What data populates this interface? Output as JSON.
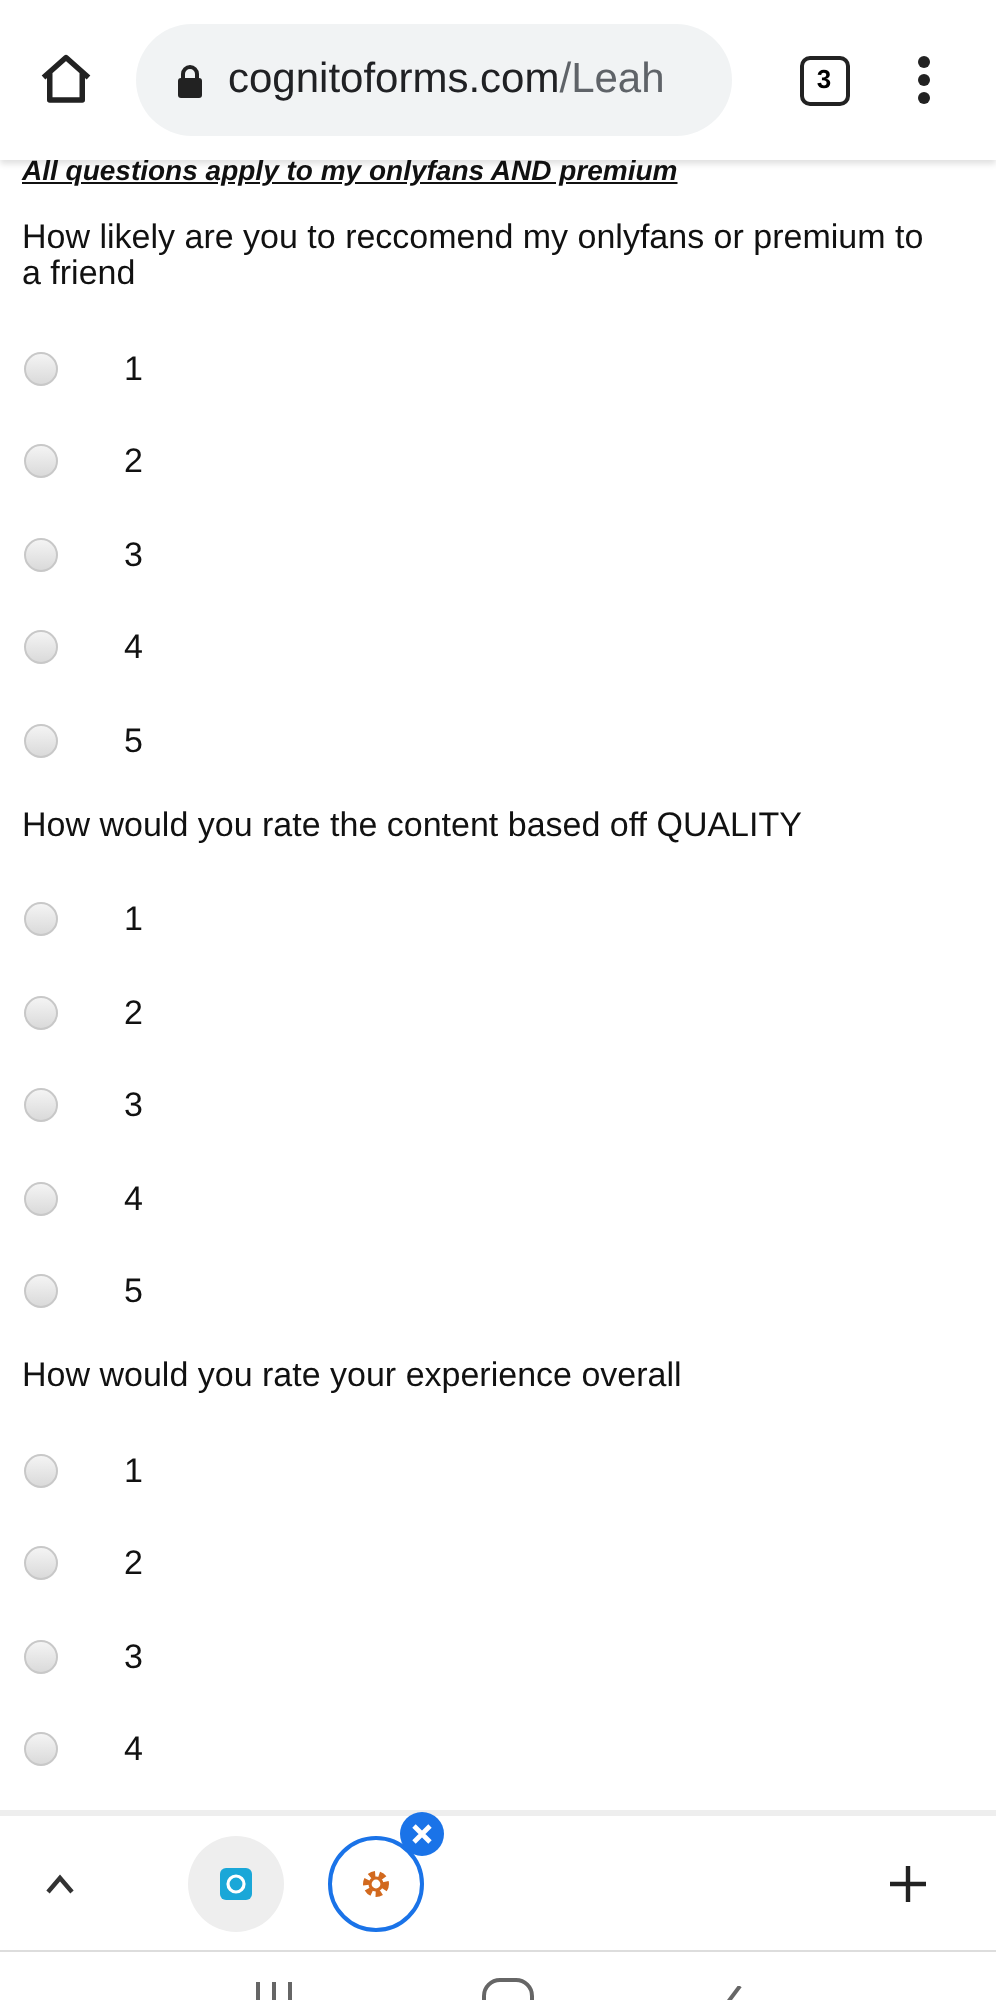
{
  "browser": {
    "url_domain": "cognitoforms.com",
    "url_path": "/Leah",
    "tab_count": "3"
  },
  "form": {
    "heading": "All questions apply to my onlyfans AND premium",
    "questions": [
      {
        "text": "How likely are you to reccomend my onlyfans or premium to a friend",
        "options": [
          {
            "label": "1",
            "selected": false
          },
          {
            "label": "2",
            "selected": false
          },
          {
            "label": "3",
            "selected": false
          },
          {
            "label": "4",
            "selected": false
          },
          {
            "label": "5",
            "selected": false
          }
        ]
      },
      {
        "text": "How would you rate the content based off QUALITY",
        "options": [
          {
            "label": "1",
            "selected": false
          },
          {
            "label": "2",
            "selected": false
          },
          {
            "label": "3",
            "selected": false
          },
          {
            "label": "4",
            "selected": false
          },
          {
            "label": "5",
            "selected": false
          }
        ]
      },
      {
        "text": "How would you rate your experience overall",
        "options": [
          {
            "label": "1",
            "selected": false
          },
          {
            "label": "2",
            "selected": false
          },
          {
            "label": "3",
            "selected": false
          },
          {
            "label": "4",
            "selected": false
          }
        ]
      }
    ]
  }
}
